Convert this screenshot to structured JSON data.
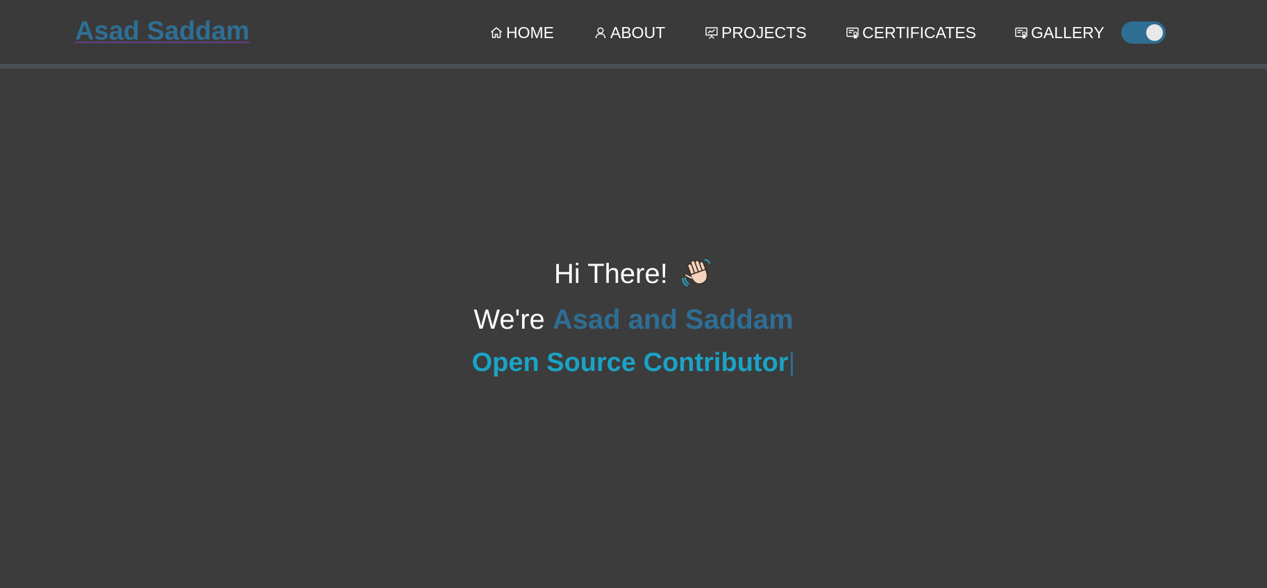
{
  "navbar": {
    "brand": "Asad Saddam",
    "items": [
      {
        "label": "HOME",
        "icon": "home-icon"
      },
      {
        "label": "ABOUT",
        "icon": "user-icon"
      },
      {
        "label": "PROJECTS",
        "icon": "presentation-chart-icon"
      },
      {
        "label": "CERTIFICATES",
        "icon": "certificate-icon"
      },
      {
        "label": "GALLERY",
        "icon": "certificate-icon"
      }
    ],
    "theme_toggle": {
      "state": "on"
    }
  },
  "hero": {
    "greeting": "Hi There!",
    "greeting_icon": "waving-hand-icon",
    "intro_prefix": "We're ",
    "intro_names": "Asad and Saddam",
    "role": "Open Source Contributor",
    "cursor": "|"
  },
  "colors": {
    "background": "#3c3c3c",
    "accent": "#2f6e93",
    "role_text": "#1aa3c6",
    "text": "#ffffff"
  }
}
